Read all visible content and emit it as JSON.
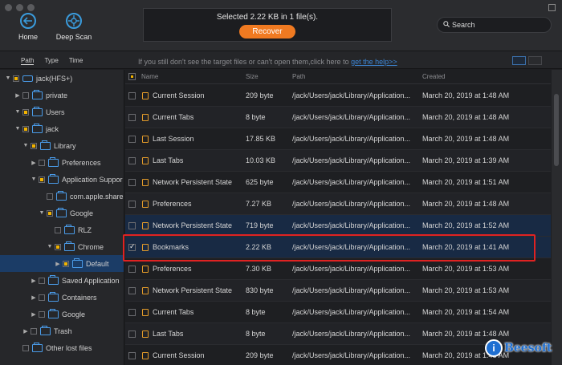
{
  "toolbar": {
    "home_label": "Home",
    "deep_scan_label": "Deep Scan",
    "status_text": "Selected 2.22 KB in 1 file(s).",
    "recover_label": "Recover",
    "search_placeholder": "Search"
  },
  "subbar": {
    "tabs": [
      "Path",
      "Type",
      "Time"
    ],
    "hint_text": "If you still don't see the target files or can't open them,click here to ",
    "hint_link": "get the help>>"
  },
  "sidebar": {
    "items": [
      {
        "label": "jack(HFS+)",
        "depth": 0,
        "expanded": true,
        "icon": "drive-icon"
      },
      {
        "label": "private",
        "depth": 1,
        "expanded": false,
        "icon": "folder-icon"
      },
      {
        "label": "Users",
        "depth": 1,
        "expanded": true,
        "icon": "folder-icon"
      },
      {
        "label": "jack",
        "depth": 2,
        "expanded": true,
        "icon": "folder-icon"
      },
      {
        "label": "Library",
        "depth": 3,
        "expanded": true,
        "icon": "folder-icon"
      },
      {
        "label": "Preferences",
        "depth": 4,
        "expanded": false,
        "icon": "folder-icon"
      },
      {
        "label": "Application Suppor",
        "depth": 4,
        "expanded": true,
        "icon": "folder-icon"
      },
      {
        "label": "com.apple.share",
        "depth": 5,
        "expanded": null,
        "icon": "folder-icon"
      },
      {
        "label": "Google",
        "depth": 5,
        "expanded": true,
        "icon": "folder-icon"
      },
      {
        "label": "RLZ",
        "depth": 6,
        "expanded": null,
        "icon": "folder-icon"
      },
      {
        "label": "Chrome",
        "depth": 6,
        "expanded": true,
        "icon": "folder-icon"
      },
      {
        "label": "Default",
        "depth": 7,
        "expanded": false,
        "icon": "folder-icon",
        "selected": true
      },
      {
        "label": "Saved Application",
        "depth": 4,
        "expanded": false,
        "icon": "folder-icon"
      },
      {
        "label": "Containers",
        "depth": 4,
        "expanded": false,
        "icon": "folder-icon"
      },
      {
        "label": "Google",
        "depth": 4,
        "expanded": false,
        "icon": "folder-icon"
      },
      {
        "label": "Trash",
        "depth": 3,
        "expanded": false,
        "icon": "folder-icon"
      },
      {
        "label": "Other lost files",
        "depth": 1,
        "expanded": null,
        "icon": "folder-icon"
      }
    ]
  },
  "list": {
    "headers": {
      "name": "Name",
      "size": "Size",
      "path": "Path",
      "created": "Created"
    },
    "rows": [
      {
        "name": "Current Session",
        "size": "209 byte",
        "path": "/jack/Users/jack/Library/Application...",
        "created": "March 20, 2019 at 1:48 AM"
      },
      {
        "name": "Current Tabs",
        "size": "8 byte",
        "path": "/jack/Users/jack/Library/Application...",
        "created": "March 20, 2019 at 1:48 AM"
      },
      {
        "name": "Last Session",
        "size": "17.85 KB",
        "path": "/jack/Users/jack/Library/Application...",
        "created": "March 20, 2019 at 1:48 AM"
      },
      {
        "name": "Last Tabs",
        "size": "10.03 KB",
        "path": "/jack/Users/jack/Library/Application...",
        "created": "March 20, 2019 at 1:39 AM"
      },
      {
        "name": "Network Persistent State",
        "size": "625 byte",
        "path": "/jack/Users/jack/Library/Application...",
        "created": "March 20, 2019 at 1:51 AM"
      },
      {
        "name": "Preferences",
        "size": "7.27 KB",
        "path": "/jack/Users/jack/Library/Application...",
        "created": "March 20, 2019 at 1:48 AM"
      },
      {
        "name": "Network Persistent State",
        "size": "719 byte",
        "path": "/jack/Users/jack/Library/Application...",
        "created": "March 20, 2019 at 1:52 AM"
      },
      {
        "name": "Bookmarks",
        "size": "2.22 KB",
        "path": "/jack/Users/jack/Library/Application...",
        "created": "March 20, 2019 at 1:41 AM",
        "checked": true
      },
      {
        "name": "Preferences",
        "size": "7.30 KB",
        "path": "/jack/Users/jack/Library/Application...",
        "created": "March 20, 2019 at 1:53 AM"
      },
      {
        "name": "Network Persistent State",
        "size": "830 byte",
        "path": "/jack/Users/jack/Library/Application...",
        "created": "March 20, 2019 at 1:53 AM"
      },
      {
        "name": "Current Tabs",
        "size": "8 byte",
        "path": "/jack/Users/jack/Library/Application...",
        "created": "March 20, 2019 at 1:54 AM"
      },
      {
        "name": "Last Tabs",
        "size": "8 byte",
        "path": "/jack/Users/jack/Library/Application...",
        "created": "March 20, 2019 at 1:48 AM"
      },
      {
        "name": "Current Session",
        "size": "209 byte",
        "path": "/jack/Users/jack/Library/Application...",
        "created": "March 20, 2019 at 1:48 AM"
      }
    ]
  },
  "watermark": {
    "badge": "i",
    "text": "Beesoft"
  },
  "colors": {
    "accent": "#f07a21",
    "selection": "#1b3c66",
    "highlight_border": "#e02222",
    "icon_blue": "#4a9be8"
  }
}
